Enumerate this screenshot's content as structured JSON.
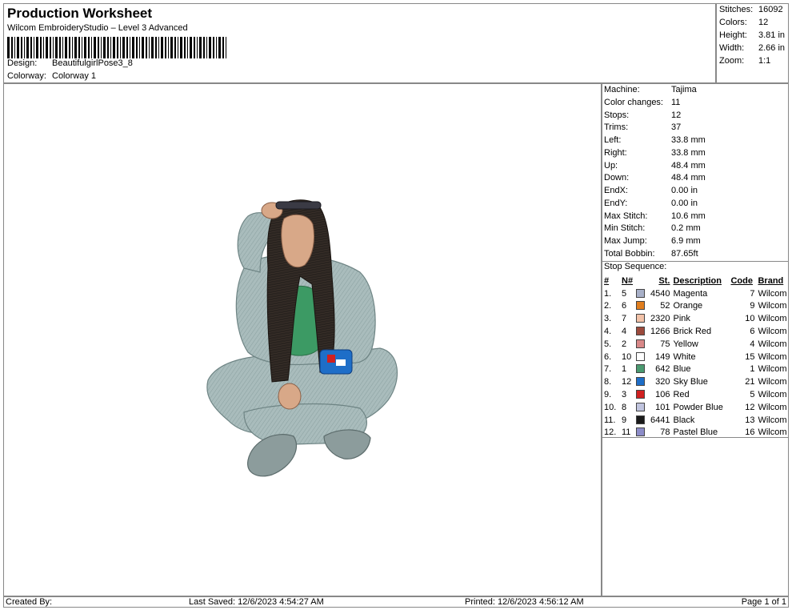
{
  "header": {
    "title": "Production Worksheet",
    "subtitle": "Wilcom EmbroideryStudio – Level 3 Advanced",
    "design_label": "Design:",
    "design_value": "BeautifulgirlPose3_8",
    "colorway_label": "Colorway:",
    "colorway_value": "Colorway 1"
  },
  "summary": [
    {
      "label": "Stitches:",
      "value": "16092"
    },
    {
      "label": "Colors:",
      "value": "12"
    },
    {
      "label": "Height:",
      "value": "3.81 in"
    },
    {
      "label": "Width:",
      "value": "2.66 in"
    },
    {
      "label": "Zoom:",
      "value": "1:1"
    }
  ],
  "machine_info": [
    {
      "label": "Machine:",
      "value": "Tajima"
    },
    {
      "label": "Color changes:",
      "value": "11"
    },
    {
      "label": "Stops:",
      "value": "12"
    },
    {
      "label": "Trims:",
      "value": "37"
    },
    {
      "label": "Left:",
      "value": "33.8 mm"
    },
    {
      "label": "Right:",
      "value": "33.8 mm"
    },
    {
      "label": "Up:",
      "value": "48.4 mm"
    },
    {
      "label": "Down:",
      "value": "48.4 mm"
    },
    {
      "label": "EndX:",
      "value": "0.00 in"
    },
    {
      "label": "EndY:",
      "value": "0.00 in"
    },
    {
      "label": "Max Stitch:",
      "value": "10.6 mm"
    },
    {
      "label": "Min Stitch:",
      "value": "0.2 mm"
    },
    {
      "label": "Max Jump:",
      "value": "6.9 mm"
    },
    {
      "label": "Total Bobbin:",
      "value": "87.65ft"
    }
  ],
  "stop_sequence": {
    "label": "Stop Sequence:",
    "columns": {
      "idx": "#",
      "needle": "N#",
      "stitches": "St.",
      "description": "Description",
      "code": "Code",
      "brand": "Brand"
    },
    "rows": [
      {
        "idx": "1.",
        "needle": "5",
        "color": "#a8b0c8",
        "stitches": "4540",
        "description": "Magenta",
        "code": "7",
        "brand": "Wilcom"
      },
      {
        "idx": "2.",
        "needle": "6",
        "color": "#e07e1e",
        "stitches": "52",
        "description": "Orange",
        "code": "9",
        "brand": "Wilcom"
      },
      {
        "idx": "3.",
        "needle": "7",
        "color": "#f2c2a8",
        "stitches": "2320",
        "description": "Pink",
        "code": "10",
        "brand": "Wilcom"
      },
      {
        "idx": "4.",
        "needle": "4",
        "color": "#9c4a3c",
        "stitches": "1266",
        "description": "Brick Red",
        "code": "6",
        "brand": "Wilcom"
      },
      {
        "idx": "5.",
        "needle": "2",
        "color": "#d88888",
        "stitches": "75",
        "description": "Yellow",
        "code": "4",
        "brand": "Wilcom"
      },
      {
        "idx": "6.",
        "needle": "10",
        "color": "#ffffff",
        "stitches": "149",
        "description": "White",
        "code": "15",
        "brand": "Wilcom"
      },
      {
        "idx": "7.",
        "needle": "1",
        "color": "#4a9a70",
        "stitches": "642",
        "description": "Blue",
        "code": "1",
        "brand": "Wilcom"
      },
      {
        "idx": "8.",
        "needle": "12",
        "color": "#1e6ec8",
        "stitches": "320",
        "description": "Sky Blue",
        "code": "21",
        "brand": "Wilcom"
      },
      {
        "idx": "9.",
        "needle": "3",
        "color": "#d02020",
        "stitches": "106",
        "description": "Red",
        "code": "5",
        "brand": "Wilcom"
      },
      {
        "idx": "10.",
        "needle": "8",
        "color": "#c0c4de",
        "stitches": "101",
        "description": "Powder Blue",
        "code": "12",
        "brand": "Wilcom"
      },
      {
        "idx": "11.",
        "needle": "9",
        "color": "#1a1a1a",
        "stitches": "6441",
        "description": "Black",
        "code": "13",
        "brand": "Wilcom"
      },
      {
        "idx": "12.",
        "needle": "11",
        "color": "#8c8cc8",
        "stitches": "78",
        "description": "Pastel Blue",
        "code": "16",
        "brand": "Wilcom"
      }
    ]
  },
  "footer": {
    "created_by": "Created By:",
    "last_saved": "Last Saved: 12/6/2023 4:54:27 AM",
    "printed": "Printed: 12/6/2023 4:56:12 AM",
    "page": "Page 1 of 1"
  },
  "colors": {
    "outfit": "#a9bcbc",
    "outfit_shade": "#7f9696",
    "hair": "#2a2420",
    "skin": "#d8a888",
    "top": "#3c9a64",
    "accent": "#1e6ec8"
  }
}
